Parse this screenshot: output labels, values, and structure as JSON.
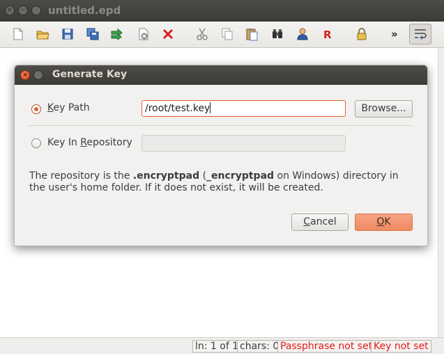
{
  "window": {
    "title": "untitled.epd",
    "close_glyph": "×",
    "min_glyph": "−"
  },
  "toolbar": {
    "icons": [
      "new-file-icon",
      "open-folder-icon",
      "save-icon",
      "save-as-icon",
      "export-icon",
      "settings-icon",
      "delete-icon",
      "cut-icon",
      "copy-icon",
      "paste-icon",
      "binoculars-icon",
      "user-icon",
      "r-icon",
      "lock-icon",
      "more-icon",
      "wrap-icon"
    ],
    "more_label": "»"
  },
  "dialog": {
    "title": "Generate Key",
    "key_path": {
      "label_pre": "",
      "label_mnemonic": "K",
      "label_post": "ey Path",
      "selected": true
    },
    "key_path_value": "/root/test.key",
    "browse_label": "Browse...",
    "key_repo": {
      "label_pre": "Key In ",
      "label_mnemonic": "R",
      "label_post": "epository",
      "selected": false
    },
    "info_pre": "The repository is the ",
    "info_bold1": ".encryptpad",
    "info_mid1": " (",
    "info_bold2": "_encryptpad",
    "info_post": " on Windows) directory in the user's home folder. If it does not exist, it will be created.",
    "cancel": {
      "mnemonic": "C",
      "rest": "ancel"
    },
    "ok": {
      "mnemonic": "O",
      "rest": "K"
    }
  },
  "status": {
    "line": "ln: 1 of 1",
    "chars": "chars: 0",
    "passphrase": "Passphrase not set",
    "key": "Key not set"
  },
  "colors": {
    "accent": "#e4602f",
    "status_red": "#e31b1b",
    "titlebar": "#3c3b37"
  }
}
